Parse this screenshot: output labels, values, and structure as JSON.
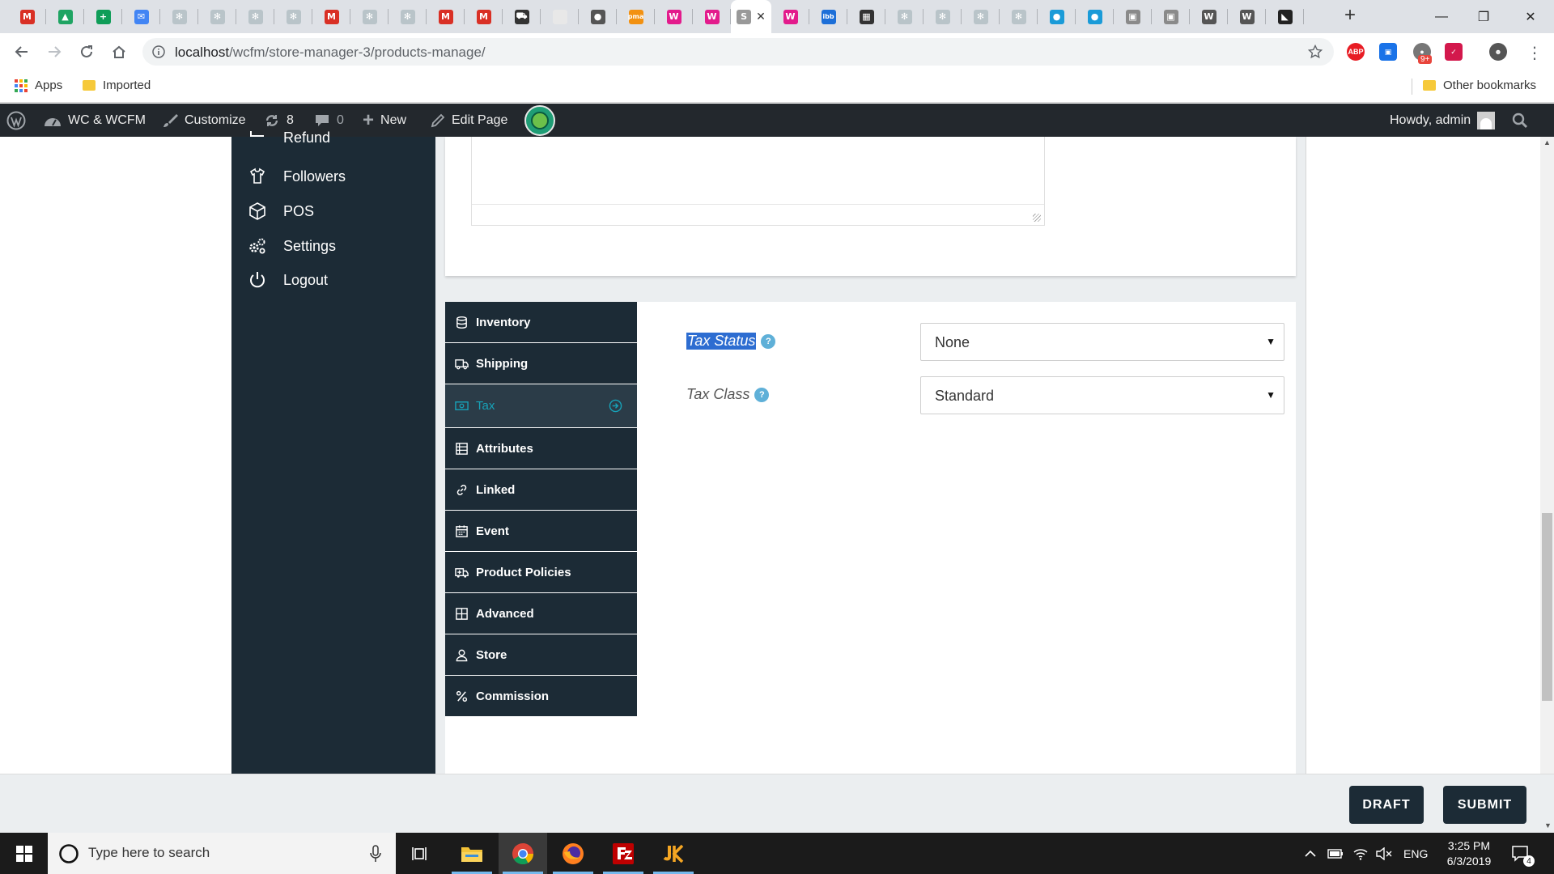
{
  "browser": {
    "tabs": [
      {
        "icon": "gmail-icon",
        "letter": "M",
        "color": "#d93025"
      },
      {
        "icon": "drive-icon",
        "letter": "▲",
        "color": "#1fa463"
      },
      {
        "icon": "sheets-icon",
        "letter": "+",
        "color": "#0f9d58"
      },
      {
        "icon": "inbox-icon",
        "letter": "✉",
        "color": "#4285f4"
      },
      {
        "icon": "wcfm-icon",
        "letter": "✻",
        "color": "#b9c4c9"
      },
      {
        "icon": "wcfm-icon",
        "letter": "✻",
        "color": "#b9c4c9"
      },
      {
        "icon": "wcfm-icon",
        "letter": "✻",
        "color": "#b9c4c9"
      },
      {
        "icon": "wcfm-icon",
        "letter": "✻",
        "color": "#b9c4c9"
      },
      {
        "icon": "gmail-icon",
        "letter": "M",
        "color": "#d93025"
      },
      {
        "icon": "wcfm-icon",
        "letter": "✻",
        "color": "#b9c4c9"
      },
      {
        "icon": "wcfm-icon",
        "letter": "✻",
        "color": "#b9c4c9"
      },
      {
        "icon": "gmail-icon",
        "letter": "M",
        "color": "#d93025"
      },
      {
        "icon": "gmail-icon",
        "letter": "M",
        "color": "#d93025"
      },
      {
        "icon": "cart-icon",
        "letter": "⛟",
        "color": "#333333"
      },
      {
        "icon": "blank-page-icon",
        "letter": "",
        "color": "#e8e8e8"
      },
      {
        "icon": "globe-icon",
        "letter": "●",
        "color": "#555555"
      },
      {
        "icon": "phpmyadmin-icon",
        "letter": "pma",
        "color": "#f29111"
      },
      {
        "icon": "woo-icon",
        "letter": "W",
        "color": "#e31b8c"
      },
      {
        "icon": "woo-icon",
        "letter": "W",
        "color": "#e31b8c"
      },
      {
        "icon": "active-tab-icon",
        "letter": "S",
        "color": "#999999",
        "active": true
      },
      {
        "icon": "woo-icon",
        "letter": "W",
        "color": "#e31b8c"
      },
      {
        "icon": "ibb-icon",
        "letter": "ibb",
        "color": "#1d6fd8"
      },
      {
        "icon": "film-icon",
        "letter": "▦",
        "color": "#333333"
      },
      {
        "icon": "wcfm-icon",
        "letter": "✻",
        "color": "#b9c4c9"
      },
      {
        "icon": "wcfm-icon",
        "letter": "✻",
        "color": "#b9c4c9"
      },
      {
        "icon": "wcfm-icon",
        "letter": "✻",
        "color": "#b9c4c9"
      },
      {
        "icon": "wcfm-icon",
        "letter": "✻",
        "color": "#b9c4c9"
      },
      {
        "icon": "circle-blue-icon",
        "letter": "●",
        "color": "#1a9bd8"
      },
      {
        "icon": "circle-blue-icon",
        "letter": "●",
        "color": "#1a9bd8"
      },
      {
        "icon": "monitor-icon",
        "letter": "▣",
        "color": "#8a8a8a"
      },
      {
        "icon": "monitor-icon",
        "letter": "▣",
        "color": "#8a8a8a"
      },
      {
        "icon": "wordpress-icon",
        "letter": "W",
        "color": "#555555"
      },
      {
        "icon": "wordpress-icon",
        "letter": "W",
        "color": "#555555"
      },
      {
        "icon": "logo-dark-icon",
        "letter": "◣",
        "color": "#222222"
      }
    ],
    "url_host": "localhost",
    "url_path": "/wcfm/store-manager-3/products-manage/",
    "ext_badge": "9+",
    "ext_abp": "ABP",
    "bookmarks": {
      "apps": "Apps",
      "imported": "Imported",
      "other": "Other bookmarks"
    }
  },
  "adminbar": {
    "site_name": "WC & WCFM",
    "customize": "Customize",
    "updates": "8",
    "comments": "0",
    "new": "New",
    "edit_page": "Edit Page",
    "howdy": "Howdy, admin"
  },
  "sidebar": {
    "partial_item": "Refund",
    "items": [
      {
        "label": "Followers",
        "icon": "followers-icon"
      },
      {
        "label": "POS",
        "icon": "cube-icon"
      },
      {
        "label": "Settings",
        "icon": "gears-icon"
      },
      {
        "label": "Logout",
        "icon": "power-icon"
      }
    ]
  },
  "product_tabs": {
    "items": [
      {
        "label": "Inventory",
        "icon": "database-icon"
      },
      {
        "label": "Shipping",
        "icon": "truck-icon"
      },
      {
        "label": "Tax",
        "icon": "money-icon",
        "active": true
      },
      {
        "label": "Attributes",
        "icon": "list-icon"
      },
      {
        "label": "Linked",
        "icon": "link-icon"
      },
      {
        "label": "Event",
        "icon": "calendar-icon"
      },
      {
        "label": "Product Policies",
        "icon": "ambulance-icon"
      },
      {
        "label": "Advanced",
        "icon": "table-icon"
      },
      {
        "label": "Store",
        "icon": "user-icon"
      },
      {
        "label": "Commission",
        "icon": "percent-icon"
      }
    ]
  },
  "tax": {
    "status_label": "Tax Status",
    "status_value": "None",
    "class_label": "Tax Class",
    "class_value": "Standard"
  },
  "footer": {
    "draft": "DRAFT",
    "submit": "SUBMIT"
  },
  "taskbar": {
    "search_placeholder": "Type here to search",
    "language": "ENG",
    "time": "3:25 PM",
    "date": "6/3/2019",
    "notifications": "4"
  },
  "colors": {
    "sidebar_bg": "#1c2b36",
    "accent": "#17a2b8",
    "adminbar_bg": "#23282d"
  }
}
